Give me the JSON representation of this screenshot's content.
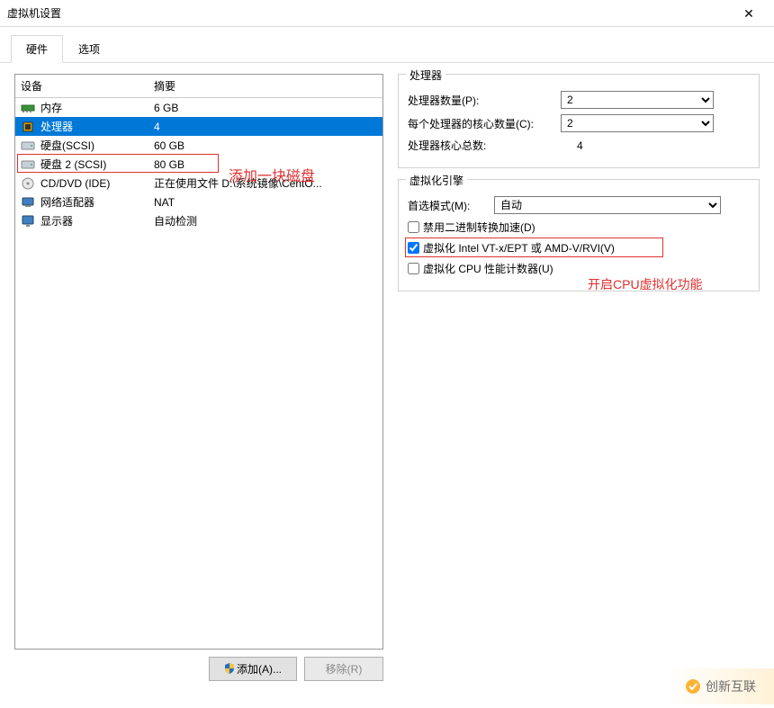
{
  "window": {
    "title": "虚拟机设置"
  },
  "tabs": {
    "hardware": "硬件",
    "options": "选项"
  },
  "deviceList": {
    "header": {
      "device": "设备",
      "summary": "摘要"
    },
    "rows": [
      {
        "id": "memory",
        "name": "内存",
        "summary": "6 GB"
      },
      {
        "id": "processor",
        "name": "处理器",
        "summary": "4"
      },
      {
        "id": "disk1",
        "name": "硬盘(SCSI)",
        "summary": "60 GB"
      },
      {
        "id": "disk2",
        "name": "硬盘 2 (SCSI)",
        "summary": "80 GB"
      },
      {
        "id": "cddvd",
        "name": "CD/DVD (IDE)",
        "summary": "正在使用文件 D:\\系统镜像\\CentO..."
      },
      {
        "id": "net",
        "name": "网络适配器",
        "summary": "NAT"
      },
      {
        "id": "display",
        "name": "显示器",
        "summary": "自动检测"
      }
    ]
  },
  "annotations": {
    "addDisk": "添加一块磁盘",
    "enableVirt": "开启CPU虚拟化功能"
  },
  "buttons": {
    "add": "添加(A)...",
    "remove": "移除(R)"
  },
  "processorGroup": {
    "title": "处理器",
    "labels": {
      "count": "处理器数量(P):",
      "cores": "每个处理器的核心数量(C):",
      "total": "处理器核心总数:"
    },
    "values": {
      "count": "2",
      "cores": "2",
      "total": "4"
    }
  },
  "virtGroup": {
    "title": "虚拟化引擎",
    "labels": {
      "mode": "首选模式(M):"
    },
    "values": {
      "mode": "自动"
    },
    "checkboxes": {
      "disable_accel": {
        "label": "禁用二进制转换加速(D)",
        "checked": false
      },
      "intel_amd": {
        "label": "虚拟化 Intel VT-x/EPT 或 AMD-V/RVI(V)",
        "checked": true
      },
      "cpu_counters": {
        "label": "虚拟化 CPU 性能计数器(U)",
        "checked": false
      }
    }
  },
  "watermark": "创新互联"
}
